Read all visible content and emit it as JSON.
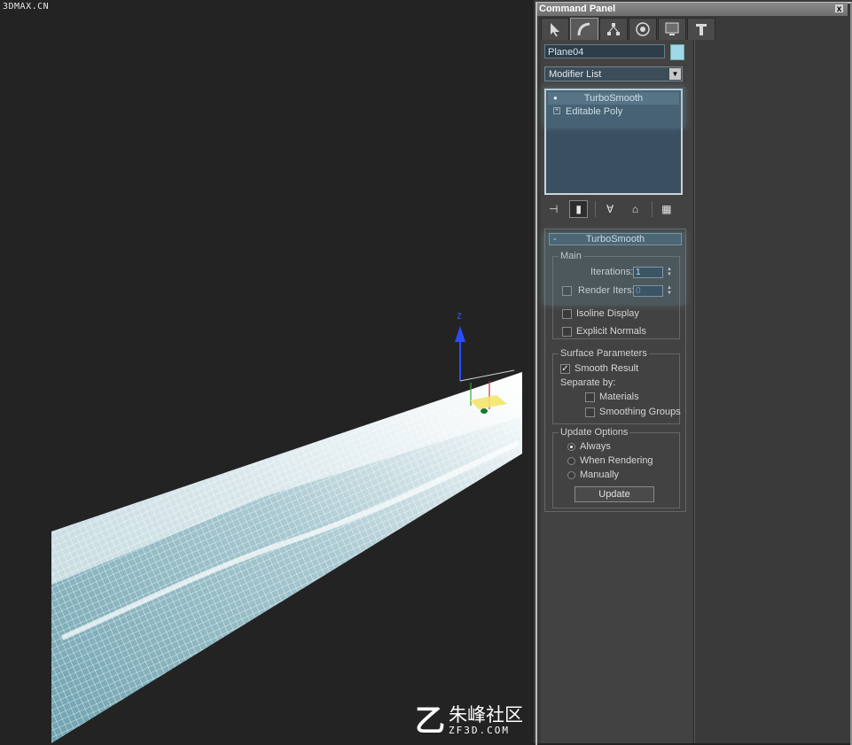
{
  "watermarks": {
    "top_left": "3DMAX.CN",
    "bottom_right_cn": "朱峰社区",
    "bottom_right_url": "ZF3D.COM",
    "bottom_right_logo": "乙"
  },
  "gizmo": {
    "axis_z": "Z"
  },
  "command_panel": {
    "title": "Command Panel",
    "close_glyph": "x",
    "tabs": [
      {
        "icon": "cursor-icon"
      },
      {
        "icon": "modify-arc-icon"
      },
      {
        "icon": "hierarchy-icon"
      },
      {
        "icon": "motion-icon"
      },
      {
        "icon": "display-icon"
      },
      {
        "icon": "utilities-hammer-icon"
      }
    ],
    "object_name": "Plane04",
    "object_color": "#9fd9e8",
    "modifier_list": "Modifier List",
    "stack": [
      {
        "label": "TurboSmooth",
        "icon": "bulb-icon"
      },
      {
        "label": "Editable Poly",
        "icon": "plus-icon"
      }
    ]
  },
  "turbosmooth": {
    "header": "TurboSmooth",
    "header_minus": "-",
    "main": {
      "title": "Main",
      "iterations_label": "Iterations:",
      "iterations_value": "1",
      "render_iters_label": "Render Iters:",
      "render_iters_value": "0",
      "render_iters_checked": false,
      "isoline_label": "Isoline Display",
      "isoline_checked": false,
      "explicit_normals_label": "Explicit Normals",
      "explicit_normals_checked": false
    },
    "surface": {
      "title": "Surface Parameters",
      "smooth_result_label": "Smooth Result",
      "smooth_result_checked": true,
      "separate_by_label": "Separate by:",
      "materials_label": "Materials",
      "materials_checked": false,
      "smoothing_groups_label": "Smoothing Groups",
      "smoothing_groups_checked": false
    },
    "update": {
      "title": "Update Options",
      "options": [
        "Always",
        "When Rendering",
        "Manually"
      ],
      "selected": "Always",
      "button": "Update"
    }
  },
  "colors": {
    "viewport_bg": "#232323",
    "panel_bg": "#424242",
    "mesh": "#ffffff",
    "mesh_fill": "#6fa3b0"
  }
}
